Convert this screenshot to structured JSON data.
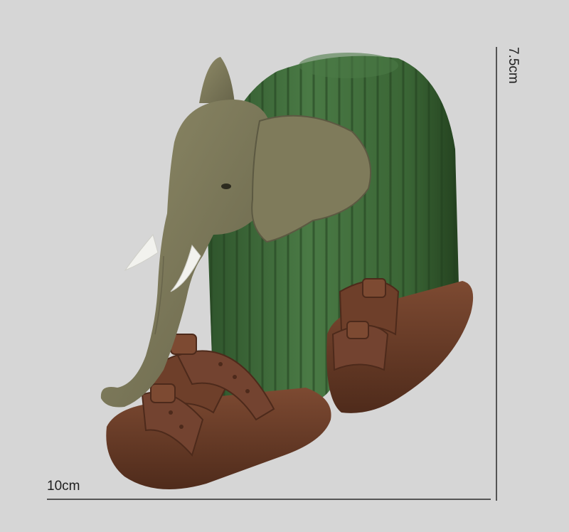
{
  "dimensions": {
    "width_label": "10cm",
    "height_label": "7.5cm"
  },
  "colors": {
    "background": "#d6d6d6",
    "elephant": "#7b7857",
    "cactus": "#3f6b3c",
    "sandal": "#6e3f2a",
    "tusk": "#f2f2ee",
    "line": "#2a2a2a"
  }
}
